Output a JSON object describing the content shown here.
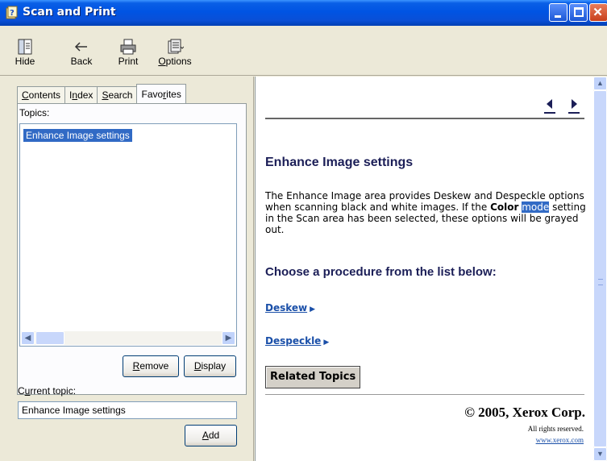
{
  "window": {
    "title": "Scan and Print"
  },
  "toolbar": {
    "hide_label": "Hide",
    "back_label": "Back",
    "print_label": "Print",
    "options_prefix": "",
    "options_accel": "O",
    "options_rest": "ptions"
  },
  "navigation": {
    "tabs": [
      {
        "accel": "C",
        "rest": "ontents"
      },
      {
        "pre": "I",
        "accel": "n",
        "rest": "dex"
      },
      {
        "accel": "S",
        "rest": "earch"
      },
      {
        "pre": "Favo",
        "accel": "r",
        "rest": "ites"
      }
    ],
    "active_tab": "Favorites",
    "topics_label": "Topics:",
    "topics": [
      "Enhance Image settings"
    ],
    "selected_topic": "Enhance Image settings",
    "remove_accel": "R",
    "remove_rest": "emove",
    "display_accel": "D",
    "display_rest": "isplay",
    "current_topic_pre": "C",
    "current_topic_accel": "u",
    "current_topic_rest": "rrent topic:",
    "current_topic_value": "Enhance Image settings",
    "add_accel": "A",
    "add_rest": "dd"
  },
  "content": {
    "heading": "Enhance Image settings",
    "para_part1": "The Enhance Image area provides Deskew and Despeckle options when scanning black and white images. If the ",
    "para_bold": "Color",
    "para_space": " ",
    "para_highlight": "mode",
    "para_part2": " setting in the Scan area has been selected, these options will be grayed out.",
    "subheading": "Choose a procedure from the list below:",
    "links": [
      "Deskew",
      "Despeckle"
    ],
    "related_topics": "Related Topics",
    "copyright": "© 2005, Xerox Corp.",
    "rights": "All rights reserved.",
    "website": "www.xerox.com"
  },
  "colors": {
    "titlebar": "#0054e3",
    "selection": "#316ac5",
    "heading": "#1b1e57",
    "link": "#1a4fa8"
  },
  "icons": [
    "help-file-icon",
    "hide-icon",
    "back-arrow-icon",
    "printer-icon",
    "options-icon",
    "prev-arrow-icon",
    "next-arrow-icon"
  ]
}
